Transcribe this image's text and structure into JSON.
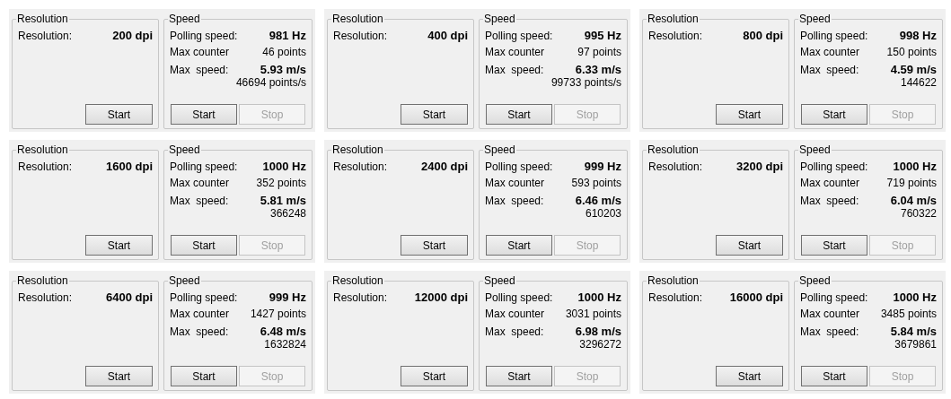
{
  "panels": [
    {
      "resolution_group": {
        "title": "Resolution",
        "label": "Resolution:",
        "value": "200 dpi",
        "button": "Start"
      },
      "speed_group": {
        "title": "Speed",
        "polling_label": "Polling speed:",
        "polling_value": "981 Hz",
        "counter_label": "Max counter",
        "counter_value": "46 points",
        "speed_label": "Max  speed:",
        "speed_value": "5.93 m/s",
        "speed_sub": "46694 points/s",
        "buttons": [
          {
            "label": "Start",
            "disabled": false
          },
          {
            "label": "Stop",
            "disabled": true
          }
        ]
      }
    },
    {
      "resolution_group": {
        "title": "Resolution",
        "label": "Resolution:",
        "value": "400 dpi",
        "button": "Start"
      },
      "speed_group": {
        "title": "Speed",
        "polling_label": "Polling speed:",
        "polling_value": "995 Hz",
        "counter_label": "Max counter",
        "counter_value": "97 points",
        "speed_label": "Max  speed:",
        "speed_value": "6.33 m/s",
        "speed_sub": "99733 points/s",
        "buttons": [
          {
            "label": "Start",
            "disabled": false
          },
          {
            "label": "Stop",
            "disabled": true
          }
        ]
      }
    },
    {
      "resolution_group": {
        "title": "Resolution",
        "label": "Resolution:",
        "value": "800 dpi",
        "button": "Start"
      },
      "speed_group": {
        "title": "Speed",
        "polling_label": "Polling speed:",
        "polling_value": "998 Hz",
        "counter_label": "Max counter",
        "counter_value": "150 points",
        "speed_label": "Max  speed:",
        "speed_value": "4.59 m/s",
        "speed_sub": "144622",
        "buttons": [
          {
            "label": "Start",
            "disabled": false
          },
          {
            "label": "Stop",
            "disabled": true
          }
        ]
      }
    },
    {
      "resolution_group": {
        "title": "Resolution",
        "label": "Resolution:",
        "value": "1600 dpi",
        "button": "Start"
      },
      "speed_group": {
        "title": "Speed",
        "polling_label": "Polling speed:",
        "polling_value": "1000 Hz",
        "counter_label": "Max counter",
        "counter_value": "352 points",
        "speed_label": "Max  speed:",
        "speed_value": "5.81 m/s",
        "speed_sub": "366248",
        "buttons": [
          {
            "label": "Start",
            "disabled": false
          },
          {
            "label": "Stop",
            "disabled": true
          }
        ]
      }
    },
    {
      "resolution_group": {
        "title": "Resolution",
        "label": "Resolution:",
        "value": "2400 dpi",
        "button": "Start"
      },
      "speed_group": {
        "title": "Speed",
        "polling_label": "Polling speed:",
        "polling_value": "999 Hz",
        "counter_label": "Max counter",
        "counter_value": "593 points",
        "speed_label": "Max  speed:",
        "speed_value": "6.46 m/s",
        "speed_sub": "610203",
        "buttons": [
          {
            "label": "Start",
            "disabled": false
          },
          {
            "label": "Stop",
            "disabled": true
          }
        ]
      }
    },
    {
      "resolution_group": {
        "title": "Resolution",
        "label": "Resolution:",
        "value": "3200 dpi",
        "button": "Start"
      },
      "speed_group": {
        "title": "Speed",
        "polling_label": "Polling speed:",
        "polling_value": "1000 Hz",
        "counter_label": "Max counter",
        "counter_value": "719 points",
        "speed_label": "Max  speed:",
        "speed_value": "6.04 m/s",
        "speed_sub": "760322",
        "buttons": [
          {
            "label": "Start",
            "disabled": false
          },
          {
            "label": "Stop",
            "disabled": true
          }
        ]
      }
    },
    {
      "resolution_group": {
        "title": "Resolution",
        "label": "Resolution:",
        "value": "6400 dpi",
        "button": "Start"
      },
      "speed_group": {
        "title": "Speed",
        "polling_label": "Polling speed:",
        "polling_value": "999 Hz",
        "counter_label": "Max counter",
        "counter_value": "1427 points",
        "speed_label": "Max  speed:",
        "speed_value": "6.48 m/s",
        "speed_sub": "1632824",
        "buttons": [
          {
            "label": "Start",
            "disabled": false
          },
          {
            "label": "Stop",
            "disabled": true
          }
        ]
      }
    },
    {
      "resolution_group": {
        "title": "Resolution",
        "label": "Resolution:",
        "value": "12000 dpi",
        "button": "Start"
      },
      "speed_group": {
        "title": "Speed",
        "polling_label": "Polling speed:",
        "polling_value": "1000 Hz",
        "counter_label": "Max counter",
        "counter_value": "3031 points",
        "speed_label": "Max  speed:",
        "speed_value": "6.98 m/s",
        "speed_sub": "3296272",
        "buttons": [
          {
            "label": "Start",
            "disabled": false
          },
          {
            "label": "Stop",
            "disabled": true
          }
        ]
      }
    },
    {
      "resolution_group": {
        "title": "Resolution",
        "label": "Resolution:",
        "value": "16000 dpi",
        "button": "Start"
      },
      "speed_group": {
        "title": "Speed",
        "polling_label": "Polling speed:",
        "polling_value": "1000 Hz",
        "counter_label": "Max counter",
        "counter_value": "3485 points",
        "speed_label": "Max  speed:",
        "speed_value": "5.84 m/s",
        "speed_sub": "3679861",
        "buttons": [
          {
            "label": "Start",
            "disabled": false
          },
          {
            "label": "Stop",
            "disabled": true
          }
        ]
      }
    }
  ]
}
